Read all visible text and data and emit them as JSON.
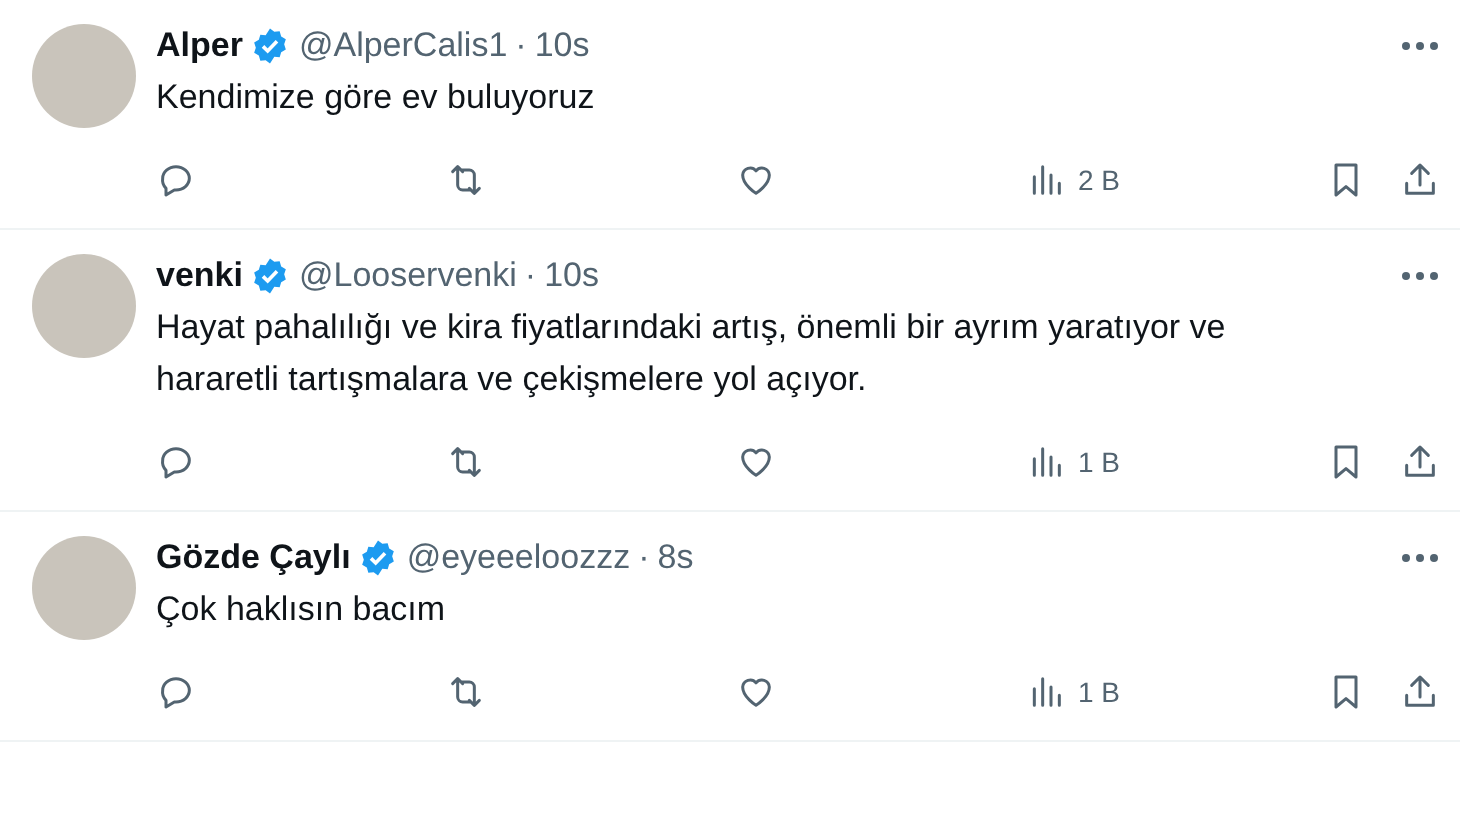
{
  "tweets": [
    {
      "name": "Alper",
      "verified": true,
      "handle": "@AlperCalis1",
      "separator": "·",
      "time": "10s",
      "text": "Kendimize göre ev buluyoruz",
      "views": "2 B"
    },
    {
      "name": "venki",
      "verified": true,
      "handle": "@Looservenki",
      "separator": "·",
      "time": "10s",
      "text": "Hayat pahalılığı ve kira fiyatlarındaki artış, önemli bir ayrım yaratıyor ve hararetli tartışmalara ve çekişmelere yol açıyor.",
      "views": "1 B"
    },
    {
      "name": "Gözde Çaylı",
      "verified": true,
      "handle": "@eyeeeloozzz",
      "separator": "·",
      "time": "8s",
      "text": "Çok haklısın bacım",
      "views": "1 B"
    }
  ]
}
